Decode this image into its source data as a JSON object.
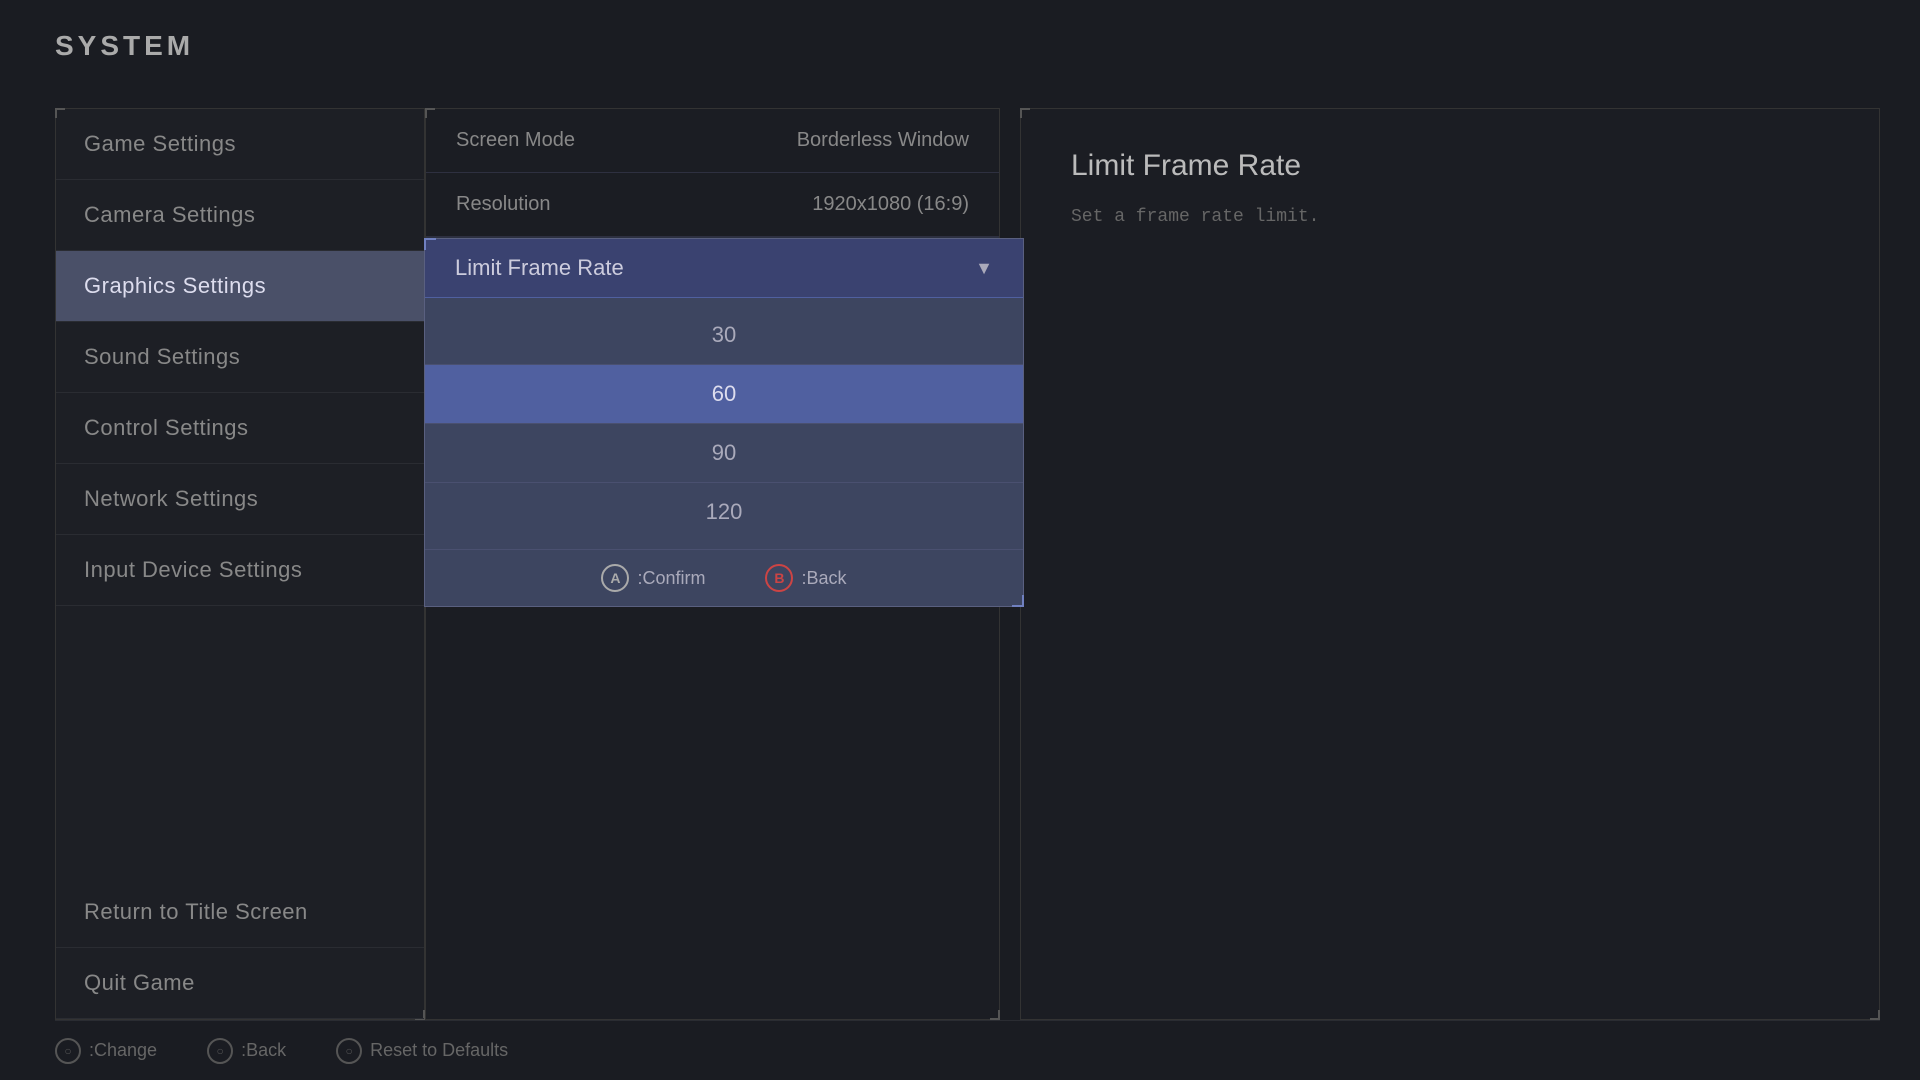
{
  "system": {
    "title": "SYSTEM"
  },
  "sidebar": {
    "items": [
      {
        "id": "game-settings",
        "label": "Game Settings",
        "active": false
      },
      {
        "id": "camera-settings",
        "label": "Camera Settings",
        "active": false
      },
      {
        "id": "graphics-settings",
        "label": "Graphics Settings",
        "active": true
      },
      {
        "id": "sound-settings",
        "label": "Sound Settings",
        "active": false
      },
      {
        "id": "control-settings",
        "label": "Control Settings",
        "active": false
      },
      {
        "id": "network-settings",
        "label": "Network Settings",
        "active": false
      },
      {
        "id": "input-device-settings",
        "label": "Input Device Settings",
        "active": false
      }
    ],
    "bottom_items": [
      {
        "id": "return-title",
        "label": "Return to Title Screen"
      },
      {
        "id": "quit-game",
        "label": "Quit Game"
      }
    ]
  },
  "center": {
    "rows": [
      {
        "label": "Screen Mode",
        "value": "Borderless Window"
      },
      {
        "label": "Resolution",
        "value": "1920x1080 (16:9)"
      },
      {
        "label": "Limit Frame Rate",
        "value": "60"
      }
    ]
  },
  "right_panel": {
    "title": "Limit Frame Rate",
    "description": "Set a frame rate limit."
  },
  "dropdown": {
    "title": "Limit Frame Rate",
    "options": [
      {
        "value": "30",
        "selected": false
      },
      {
        "value": "60",
        "selected": true
      },
      {
        "value": "90",
        "selected": false
      },
      {
        "value": "120",
        "selected": false
      }
    ],
    "confirm_label": ":Confirm",
    "back_label": ":Back"
  },
  "bottom_bar": {
    "hints": [
      {
        "icon": "circle",
        "label": ":Change"
      },
      {
        "icon": "circle",
        "label": ":Back"
      },
      {
        "icon": "circle",
        "label": "Reset to Defaults"
      }
    ]
  }
}
